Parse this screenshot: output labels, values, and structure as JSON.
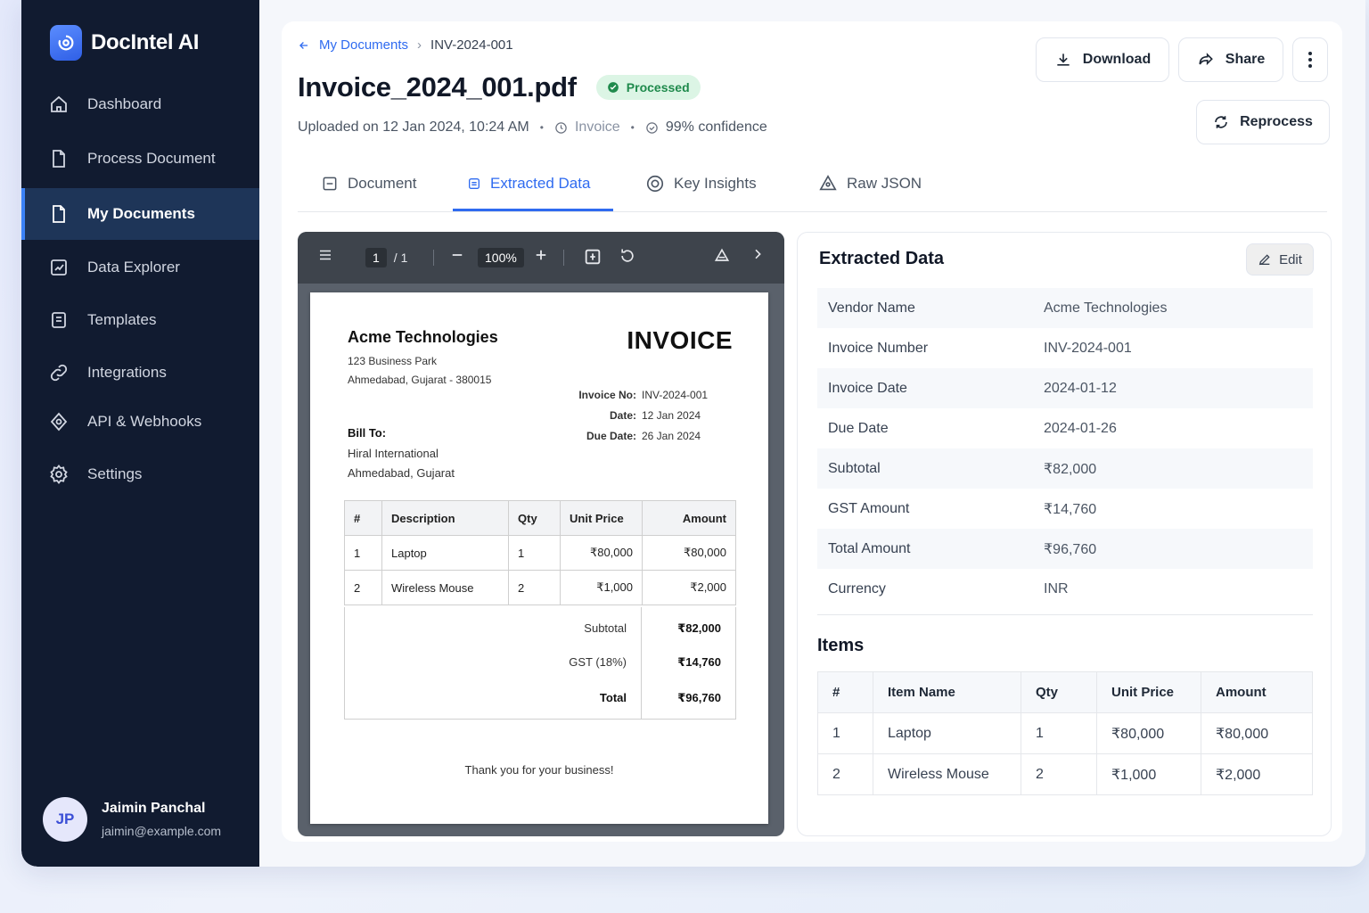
{
  "app": {
    "name": "DocIntel AI"
  },
  "sidebar": {
    "items": [
      {
        "label": "Dashboard",
        "icon": "home-icon"
      },
      {
        "label": "Process Document",
        "icon": "file-icon"
      },
      {
        "label": "My Documents",
        "icon": "document-icon",
        "active": true
      },
      {
        "label": "Data Explorer",
        "icon": "chart-icon"
      },
      {
        "label": "Templates",
        "icon": "template-icon"
      },
      {
        "label": "Integrations",
        "icon": "link-icon"
      },
      {
        "label": "API & Webhooks",
        "icon": "webhook-icon"
      },
      {
        "label": "Settings",
        "icon": "gear-icon"
      }
    ],
    "user": {
      "initials": "JP",
      "name": "Jaimin Panchal",
      "email": "jaimin@example.com"
    }
  },
  "header": {
    "breadcrumb": {
      "parent": "My Documents",
      "current": "INV-2024-001"
    },
    "title": "Invoice_2024_001.pdf",
    "status": "Processed",
    "uploaded": "Uploaded on 12 Jan 2024, 10:24 AM",
    "doc_type": "Invoice",
    "confidence": "99% confidence",
    "download_label": "Download",
    "share_label": "Share",
    "reprocess_label": "Reprocess"
  },
  "tabs": [
    {
      "label": "Document"
    },
    {
      "label": "Extracted Data",
      "active": true
    },
    {
      "label": "Key Insights"
    },
    {
      "label": "Raw JSON"
    }
  ],
  "viewer": {
    "page_current": "1",
    "page_sep": "/ 1",
    "zoom": "100%"
  },
  "invoice": {
    "company": "Acme Technologies",
    "address1": "123 Business Park",
    "address2": "Ahmedabad, Gujarat - 380015",
    "heading": "INVOICE",
    "meta": [
      {
        "k": "Invoice No:",
        "v": "INV-2024-001"
      },
      {
        "k": "Date:",
        "v": "12 Jan 2024"
      },
      {
        "k": "Due Date:",
        "v": "26 Jan 2024"
      }
    ],
    "bill_to_label": "Bill To:",
    "bill_to_1": "Hiral International",
    "bill_to_2": "Ahmedabad, Gujarat",
    "columns": [
      "#",
      "Description",
      "Qty",
      "Unit Price",
      "Amount"
    ],
    "rows": [
      [
        "1",
        "Laptop",
        "1",
        "₹80,000",
        "₹80,000"
      ],
      [
        "2",
        "Wireless Mouse",
        "2",
        "₹1,000",
        "₹2,000"
      ]
    ],
    "subtotal_label": "Subtotal",
    "subtotal": "₹82,000",
    "gst_label": "GST (18%)",
    "gst": "₹14,760",
    "total_label": "Total",
    "total": "₹96,760",
    "thanks": "Thank you for your business!"
  },
  "extracted": {
    "title": "Extracted Data",
    "edit_label": "Edit",
    "fields": [
      {
        "k": "Vendor Name",
        "v": "Acme Technologies"
      },
      {
        "k": "Invoice Number",
        "v": "INV-2024-001"
      },
      {
        "k": "Invoice Date",
        "v": "2024-01-12"
      },
      {
        "k": "Due Date",
        "v": "2024-01-26"
      },
      {
        "k": "Subtotal",
        "v": "₹82,000"
      },
      {
        "k": "GST Amount",
        "v": "₹14,760"
      },
      {
        "k": "Total Amount",
        "v": "₹96,760"
      },
      {
        "k": "Currency",
        "v": "INR"
      }
    ],
    "items_title": "Items",
    "item_columns": [
      "#",
      "Item Name",
      "Qty",
      "Unit Price",
      "Amount"
    ],
    "items": [
      [
        "1",
        "Laptop",
        "1",
        "₹80,000",
        "₹80,000"
      ],
      [
        "2",
        "Wireless Mouse",
        "2",
        "₹1,000",
        "₹2,000"
      ]
    ]
  },
  "colors": {
    "accent": "#2f6bf0",
    "sidebar_bg": "#111b30",
    "success": "#1f8a4c"
  }
}
